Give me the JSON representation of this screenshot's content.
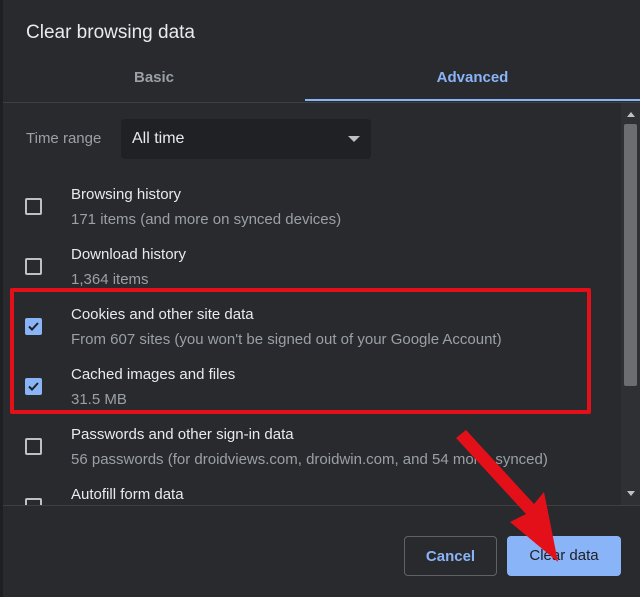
{
  "dialog": {
    "title": "Clear browsing data",
    "tabs": [
      {
        "label": "Basic",
        "active": false
      },
      {
        "label": "Advanced",
        "active": true
      }
    ],
    "time_range": {
      "label": "Time range",
      "selected": "All time"
    },
    "items": [
      {
        "title": "Browsing history",
        "description": "171 items (and more on synced devices)",
        "checked": false
      },
      {
        "title": "Download history",
        "description": "1,364 items",
        "checked": false
      },
      {
        "title": "Cookies and other site data",
        "description": "From 607 sites (you won't be signed out of your Google Account)",
        "checked": true
      },
      {
        "title": "Cached images and files",
        "description": "31.5 MB",
        "checked": true
      },
      {
        "title": "Passwords and other sign-in data",
        "description": "56 passwords (for droidviews.com, droidwin.com, and 54 more, synced)",
        "checked": false
      },
      {
        "title": "Autofill form data",
        "description": "",
        "checked": false
      }
    ],
    "buttons": {
      "cancel": "Cancel",
      "clear": "Clear data"
    }
  },
  "colors": {
    "background": "#292a2d",
    "accent": "#8ab4f8",
    "highlight": "#e3101a"
  },
  "icons": {
    "checkbox_check": "check-icon",
    "dropdown": "chevron-down-icon",
    "arrow": "red-arrow-annotation-icon"
  }
}
